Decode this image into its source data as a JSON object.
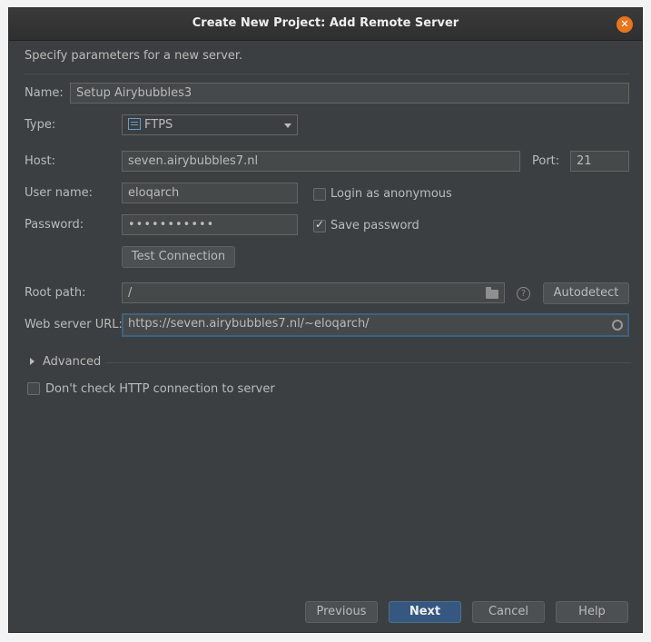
{
  "window": {
    "title": "Create New Project: Add Remote Server"
  },
  "description": "Specify parameters for a new server.",
  "form": {
    "name_label": "Name:",
    "name_value": "Setup Airybubbles3",
    "type_label": "Type:",
    "type_value": "FTPS",
    "host_label": "Host:",
    "host_value": "seven.airybubbles7.nl",
    "port_label": "Port:",
    "port_value": "21",
    "username_label": "User name:",
    "username_value": "eloqarch",
    "anonymous_label": "Login as anonymous",
    "password_label": "Password:",
    "password_value": "•••••••••••",
    "save_password_label": "Save password",
    "test_connection_label": "Test Connection",
    "root_path_label": "Root path:",
    "root_path_value": "/",
    "autodetect_label": "Autodetect",
    "web_url_label": "Web server URL:",
    "web_url_value": "https://seven.airybubbles7.nl/~eloqarch/",
    "advanced_label": "Advanced",
    "dont_check_label": "Don't check HTTP connection to server"
  },
  "buttons": {
    "previous": "Previous",
    "next": "Next",
    "cancel": "Cancel",
    "help": "Help"
  },
  "state": {
    "login_anonymous": false,
    "save_password": true,
    "dont_check_http": false
  },
  "colors": {
    "background": "#3c3f41",
    "accent": "#365880",
    "close_button": "#e5761e"
  }
}
